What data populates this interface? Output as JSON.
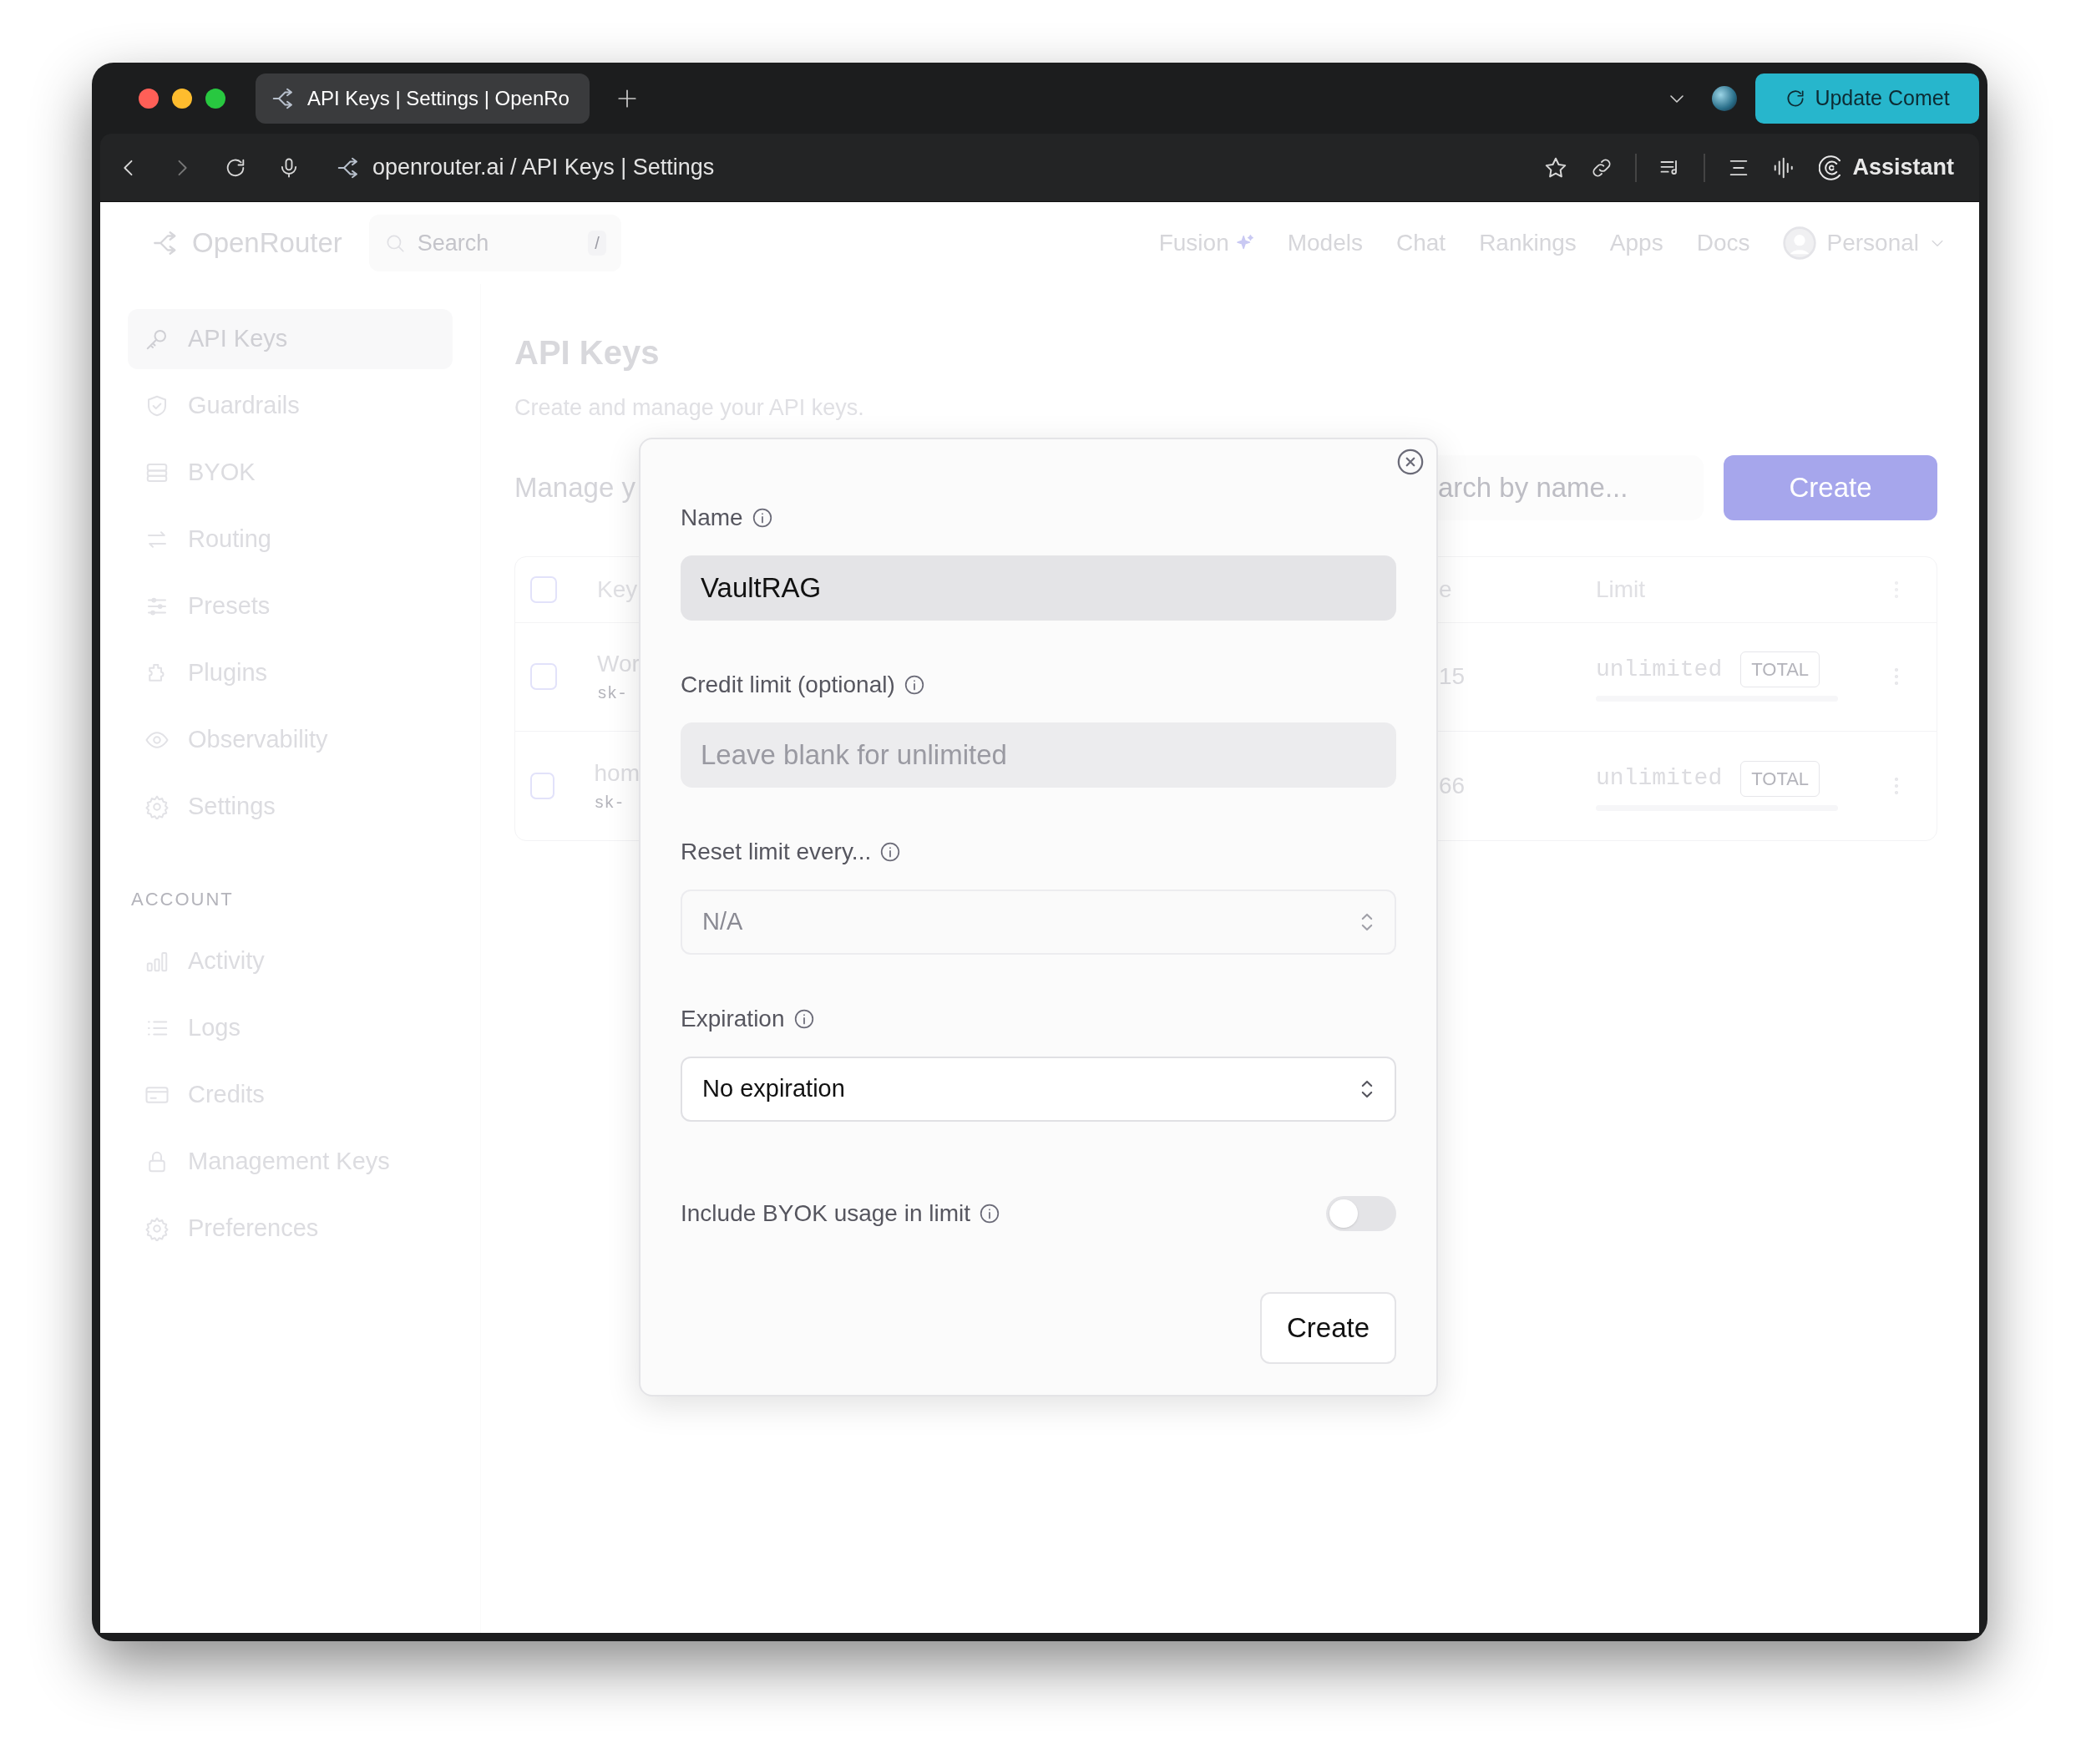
{
  "browser": {
    "tab_title": "API Keys | Settings | OpenRo",
    "address": "openrouter.ai / API Keys | Settings",
    "update_button": "Update Comet",
    "assistant_button": "Assistant"
  },
  "header": {
    "brand": "OpenRouter",
    "search": {
      "placeholder": "Search",
      "shortcut": "/"
    },
    "nav": [
      "Fusion",
      "Models",
      "Chat",
      "Rankings",
      "Apps",
      "Docs"
    ],
    "account": "Personal"
  },
  "sidebar": {
    "items": [
      {
        "label": "API Keys",
        "selected": true
      },
      {
        "label": "Guardrails",
        "selected": false
      },
      {
        "label": "BYOK",
        "selected": false
      },
      {
        "label": "Routing",
        "selected": false
      },
      {
        "label": "Presets",
        "selected": false
      },
      {
        "label": "Plugins",
        "selected": false
      },
      {
        "label": "Observability",
        "selected": false
      },
      {
        "label": "Settings",
        "selected": false
      }
    ],
    "section_label": "ACCOUNT",
    "account_items": [
      {
        "label": "Activity",
        "selected": false
      },
      {
        "label": "Logs",
        "selected": false
      },
      {
        "label": "Credits",
        "selected": false
      },
      {
        "label": "Management Keys",
        "selected": false
      },
      {
        "label": "Preferences",
        "selected": false
      }
    ]
  },
  "page": {
    "title": "API Keys",
    "subtitle": "Create and manage your API keys.",
    "manage_text": "Manage y",
    "search": {
      "placeholder": "arch by name..."
    },
    "create_button": "Create"
  },
  "table": {
    "header_checked": false,
    "columns": [
      "Key",
      "e",
      "Limit"
    ],
    "rows": [
      {
        "checked": false,
        "column_1": "Wor",
        "column_1_sub": "sk-",
        "column_2": "15",
        "limit": "unlimited",
        "badge": "TOTAL"
      },
      {
        "checked": false,
        "column_1": "hom",
        "column_1_sub": "sk-",
        "column_2": "66",
        "limit": "unlimited",
        "badge": "TOTAL"
      }
    ]
  },
  "dialog": {
    "fields": [
      {
        "kind": "text",
        "label": "Name",
        "value": "VaultRAG"
      },
      {
        "kind": "text",
        "label": "Credit limit (optional)",
        "placeholder": "Leave blank for unlimited"
      },
      {
        "kind": "select",
        "label": "Reset limit every...",
        "value": "N/A",
        "disabled": true
      },
      {
        "kind": "select",
        "label": "Expiration",
        "value": "No expiration",
        "disabled": false
      }
    ],
    "toggle": {
      "label": "Include BYOK usage in limit",
      "on": false
    },
    "button": "Create"
  }
}
